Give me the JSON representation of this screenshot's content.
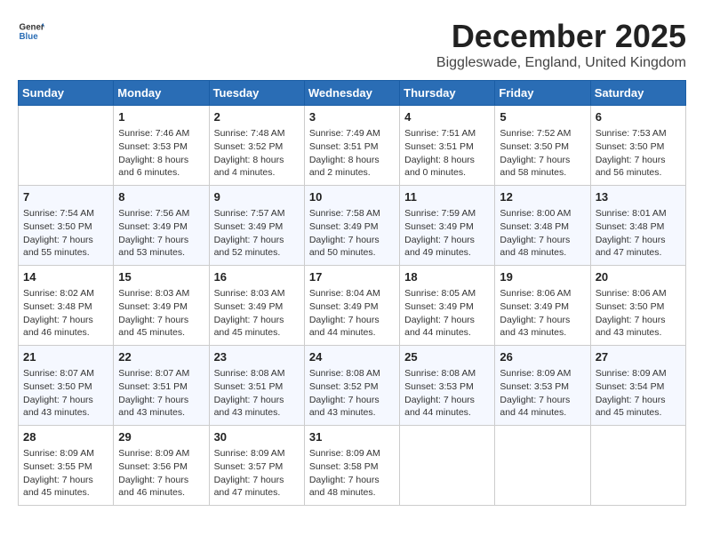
{
  "logo": {
    "general": "General",
    "blue": "Blue"
  },
  "title": "December 2025",
  "subtitle": "Biggleswade, England, United Kingdom",
  "days_of_week": [
    "Sunday",
    "Monday",
    "Tuesday",
    "Wednesday",
    "Thursday",
    "Friday",
    "Saturday"
  ],
  "weeks": [
    [
      {
        "day": "",
        "sunrise": "",
        "sunset": "",
        "daylight": ""
      },
      {
        "day": "1",
        "sunrise": "Sunrise: 7:46 AM",
        "sunset": "Sunset: 3:53 PM",
        "daylight": "Daylight: 8 hours and 6 minutes."
      },
      {
        "day": "2",
        "sunrise": "Sunrise: 7:48 AM",
        "sunset": "Sunset: 3:52 PM",
        "daylight": "Daylight: 8 hours and 4 minutes."
      },
      {
        "day": "3",
        "sunrise": "Sunrise: 7:49 AM",
        "sunset": "Sunset: 3:51 PM",
        "daylight": "Daylight: 8 hours and 2 minutes."
      },
      {
        "day": "4",
        "sunrise": "Sunrise: 7:51 AM",
        "sunset": "Sunset: 3:51 PM",
        "daylight": "Daylight: 8 hours and 0 minutes."
      },
      {
        "day": "5",
        "sunrise": "Sunrise: 7:52 AM",
        "sunset": "Sunset: 3:50 PM",
        "daylight": "Daylight: 7 hours and 58 minutes."
      },
      {
        "day": "6",
        "sunrise": "Sunrise: 7:53 AM",
        "sunset": "Sunset: 3:50 PM",
        "daylight": "Daylight: 7 hours and 56 minutes."
      }
    ],
    [
      {
        "day": "7",
        "sunrise": "Sunrise: 7:54 AM",
        "sunset": "Sunset: 3:50 PM",
        "daylight": "Daylight: 7 hours and 55 minutes."
      },
      {
        "day": "8",
        "sunrise": "Sunrise: 7:56 AM",
        "sunset": "Sunset: 3:49 PM",
        "daylight": "Daylight: 7 hours and 53 minutes."
      },
      {
        "day": "9",
        "sunrise": "Sunrise: 7:57 AM",
        "sunset": "Sunset: 3:49 PM",
        "daylight": "Daylight: 7 hours and 52 minutes."
      },
      {
        "day": "10",
        "sunrise": "Sunrise: 7:58 AM",
        "sunset": "Sunset: 3:49 PM",
        "daylight": "Daylight: 7 hours and 50 minutes."
      },
      {
        "day": "11",
        "sunrise": "Sunrise: 7:59 AM",
        "sunset": "Sunset: 3:49 PM",
        "daylight": "Daylight: 7 hours and 49 minutes."
      },
      {
        "day": "12",
        "sunrise": "Sunrise: 8:00 AM",
        "sunset": "Sunset: 3:48 PM",
        "daylight": "Daylight: 7 hours and 48 minutes."
      },
      {
        "day": "13",
        "sunrise": "Sunrise: 8:01 AM",
        "sunset": "Sunset: 3:48 PM",
        "daylight": "Daylight: 7 hours and 47 minutes."
      }
    ],
    [
      {
        "day": "14",
        "sunrise": "Sunrise: 8:02 AM",
        "sunset": "Sunset: 3:48 PM",
        "daylight": "Daylight: 7 hours and 46 minutes."
      },
      {
        "day": "15",
        "sunrise": "Sunrise: 8:03 AM",
        "sunset": "Sunset: 3:49 PM",
        "daylight": "Daylight: 7 hours and 45 minutes."
      },
      {
        "day": "16",
        "sunrise": "Sunrise: 8:03 AM",
        "sunset": "Sunset: 3:49 PM",
        "daylight": "Daylight: 7 hours and 45 minutes."
      },
      {
        "day": "17",
        "sunrise": "Sunrise: 8:04 AM",
        "sunset": "Sunset: 3:49 PM",
        "daylight": "Daylight: 7 hours and 44 minutes."
      },
      {
        "day": "18",
        "sunrise": "Sunrise: 8:05 AM",
        "sunset": "Sunset: 3:49 PM",
        "daylight": "Daylight: 7 hours and 44 minutes."
      },
      {
        "day": "19",
        "sunrise": "Sunrise: 8:06 AM",
        "sunset": "Sunset: 3:49 PM",
        "daylight": "Daylight: 7 hours and 43 minutes."
      },
      {
        "day": "20",
        "sunrise": "Sunrise: 8:06 AM",
        "sunset": "Sunset: 3:50 PM",
        "daylight": "Daylight: 7 hours and 43 minutes."
      }
    ],
    [
      {
        "day": "21",
        "sunrise": "Sunrise: 8:07 AM",
        "sunset": "Sunset: 3:50 PM",
        "daylight": "Daylight: 7 hours and 43 minutes."
      },
      {
        "day": "22",
        "sunrise": "Sunrise: 8:07 AM",
        "sunset": "Sunset: 3:51 PM",
        "daylight": "Daylight: 7 hours and 43 minutes."
      },
      {
        "day": "23",
        "sunrise": "Sunrise: 8:08 AM",
        "sunset": "Sunset: 3:51 PM",
        "daylight": "Daylight: 7 hours and 43 minutes."
      },
      {
        "day": "24",
        "sunrise": "Sunrise: 8:08 AM",
        "sunset": "Sunset: 3:52 PM",
        "daylight": "Daylight: 7 hours and 43 minutes."
      },
      {
        "day": "25",
        "sunrise": "Sunrise: 8:08 AM",
        "sunset": "Sunset: 3:53 PM",
        "daylight": "Daylight: 7 hours and 44 minutes."
      },
      {
        "day": "26",
        "sunrise": "Sunrise: 8:09 AM",
        "sunset": "Sunset: 3:53 PM",
        "daylight": "Daylight: 7 hours and 44 minutes."
      },
      {
        "day": "27",
        "sunrise": "Sunrise: 8:09 AM",
        "sunset": "Sunset: 3:54 PM",
        "daylight": "Daylight: 7 hours and 45 minutes."
      }
    ],
    [
      {
        "day": "28",
        "sunrise": "Sunrise: 8:09 AM",
        "sunset": "Sunset: 3:55 PM",
        "daylight": "Daylight: 7 hours and 45 minutes."
      },
      {
        "day": "29",
        "sunrise": "Sunrise: 8:09 AM",
        "sunset": "Sunset: 3:56 PM",
        "daylight": "Daylight: 7 hours and 46 minutes."
      },
      {
        "day": "30",
        "sunrise": "Sunrise: 8:09 AM",
        "sunset": "Sunset: 3:57 PM",
        "daylight": "Daylight: 7 hours and 47 minutes."
      },
      {
        "day": "31",
        "sunrise": "Sunrise: 8:09 AM",
        "sunset": "Sunset: 3:58 PM",
        "daylight": "Daylight: 7 hours and 48 minutes."
      },
      {
        "day": "",
        "sunrise": "",
        "sunset": "",
        "daylight": ""
      },
      {
        "day": "",
        "sunrise": "",
        "sunset": "",
        "daylight": ""
      },
      {
        "day": "",
        "sunrise": "",
        "sunset": "",
        "daylight": ""
      }
    ]
  ]
}
